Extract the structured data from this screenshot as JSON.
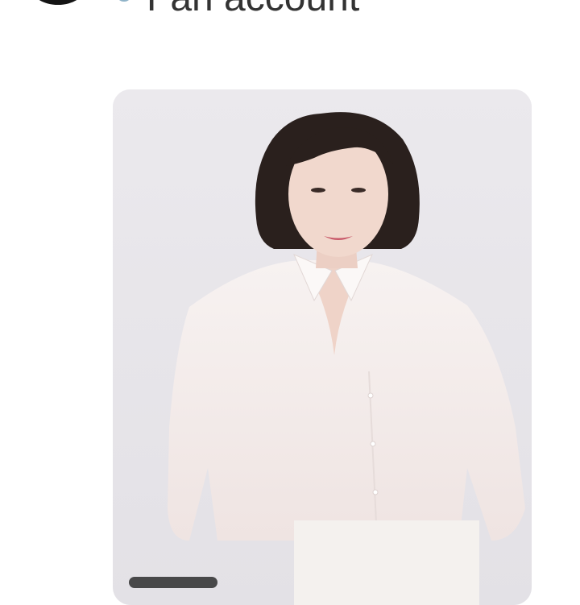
{
  "header": {
    "account_name": "Fan account",
    "avatar_icon": "profile-avatar",
    "badge_icon": "verified-badge-icon"
  },
  "post": {
    "media_type": "photo",
    "indicator_icon": "media-indicator-pill"
  },
  "colors": {
    "background": "#ffffff",
    "card_background": "#ecebee",
    "header_text": "#333333"
  }
}
